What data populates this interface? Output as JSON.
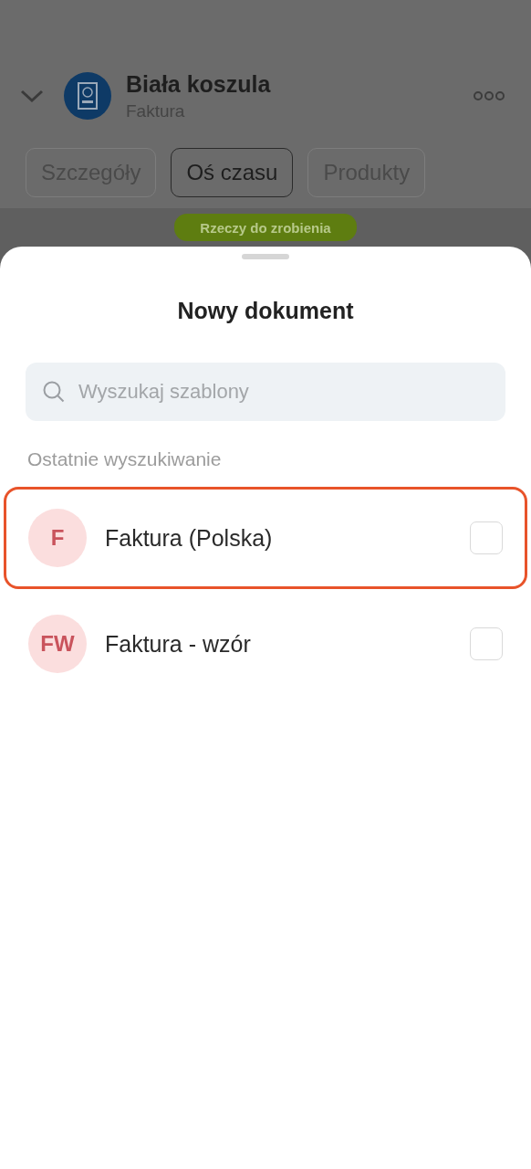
{
  "header": {
    "title": "Biała koszula",
    "subtitle": "Faktura"
  },
  "tabs": [
    {
      "label": "Szczegóły",
      "selected": false
    },
    {
      "label": "Oś czasu",
      "selected": true
    },
    {
      "label": "Produkty",
      "selected": false
    }
  ],
  "todo_button": {
    "label": "Rzeczy do zrobienia"
  },
  "sheet": {
    "title": "Nowy dokument",
    "search": {
      "placeholder": "Wyszukaj szablony"
    },
    "section_label": "Ostatnie wyszukiwanie",
    "templates": [
      {
        "initials": "F",
        "name": "Faktura (Polska)",
        "checked": false,
        "highlighted": true
      },
      {
        "initials": "FW",
        "name": "Faktura - wzór",
        "checked": false,
        "highlighted": false
      }
    ]
  }
}
